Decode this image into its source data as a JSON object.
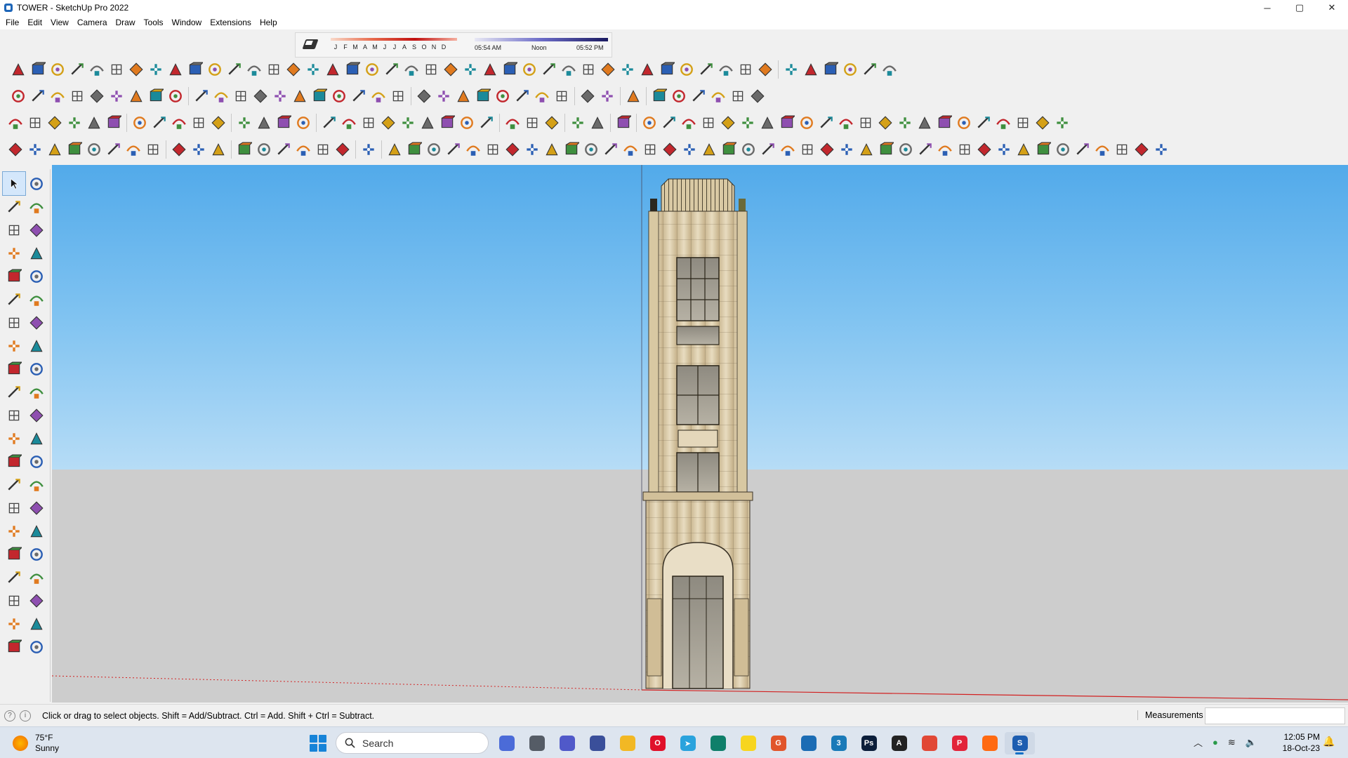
{
  "window": {
    "title": "TOWER - SketchUp Pro 2022",
    "controls": {
      "minimize": "─",
      "maximize": "▢",
      "close": "✕"
    }
  },
  "menu": [
    "File",
    "Edit",
    "View",
    "Camera",
    "Draw",
    "Tools",
    "Window",
    "Extensions",
    "Help"
  ],
  "shadows": {
    "months": [
      "J",
      "F",
      "M",
      "A",
      "M",
      "J",
      "J",
      "A",
      "S",
      "O",
      "N",
      "D"
    ],
    "sunrise": "05:54 AM",
    "noon": "Noon",
    "sunset": "05:52 PM"
  },
  "colors": {
    "sky_top": "#52aaea",
    "ground": "#cdcdcd",
    "stone": "#e3d3b2",
    "red_axis": "#d22020",
    "green_axis": "#2a9a2a",
    "blue_axis": "#2030a0",
    "taskbar": "#dde5ef"
  },
  "status": {
    "hint": "Click or drag to select objects. Shift = Add/Subtract. Ctrl = Add. Shift + Ctrl = Subtract.",
    "measurements_label": "Measurements",
    "measurements_value": ""
  },
  "taskbar": {
    "weather_temp": "75°F",
    "weather_cond": "Sunny",
    "search_placeholder": "Search",
    "apps": [
      {
        "name": "copilot-icon",
        "glyph": "",
        "color": "#4b6bd8"
      },
      {
        "name": "task-view-icon",
        "glyph": "",
        "color": "#555c66"
      },
      {
        "name": "teams-icon",
        "glyph": "",
        "color": "#5059c9"
      },
      {
        "name": "calculator-icon",
        "glyph": "",
        "color": "#3a4f9a"
      },
      {
        "name": "file-explorer-icon",
        "glyph": "",
        "color": "#f2b824"
      },
      {
        "name": "opera-icon",
        "glyph": "O",
        "color": "#e0102a"
      },
      {
        "name": "telegram-icon",
        "glyph": "➤",
        "color": "#2aa3dd"
      },
      {
        "name": "app-green-icon",
        "glyph": "",
        "color": "#0f7f6a"
      },
      {
        "name": "sticky-notes-icon",
        "glyph": "",
        "color": "#f7d51f"
      },
      {
        "name": "grammarly-icon",
        "glyph": "G",
        "color": "#e1552b"
      },
      {
        "name": "steam-icon",
        "glyph": "",
        "color": "#1b6cb4"
      },
      {
        "name": "sketchup-3-icon",
        "glyph": "3",
        "color": "#1a7ab8"
      },
      {
        "name": "photoshop-icon",
        "glyph": "Ps",
        "color": "#0b1e3a"
      },
      {
        "name": "autodesk-icon",
        "glyph": "A",
        "color": "#222222"
      },
      {
        "name": "chrome-icon",
        "glyph": "",
        "color": "#e14836"
      },
      {
        "name": "pinterest-icon",
        "glyph": "P",
        "color": "#e2243a"
      },
      {
        "name": "soundcloud-icon",
        "glyph": "",
        "color": "#ff6a12"
      },
      {
        "name": "sketchup-icon",
        "glyph": "S",
        "color": "#1d5db0"
      }
    ],
    "time": "12:05 PM",
    "date": "18-Oct-23"
  }
}
